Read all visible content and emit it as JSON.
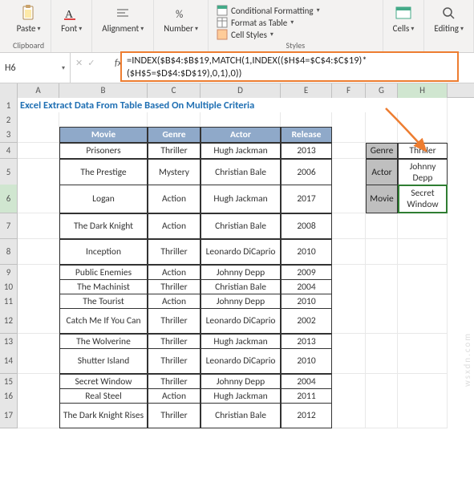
{
  "ribbon": {
    "clipboard": {
      "paste": "Paste",
      "label": "Clipboard"
    },
    "font": {
      "btn": "Font"
    },
    "alignment": {
      "btn": "Alignment"
    },
    "number": {
      "btn": "Number"
    },
    "styles": {
      "conditional": "Conditional Formatting",
      "table": "Format as Table",
      "cell": "Cell Styles",
      "label": "Styles"
    },
    "cells": {
      "btn": "Cells"
    },
    "editing": {
      "btn": "Editing"
    }
  },
  "namebox": "H6",
  "fx_label": "fx",
  "formula": "=INDEX($B$4:$B$19,MATCH(1,INDEX(($H$4=$C$4:$C$19)*($H$5=$D$4:$D$19),0,1),0))",
  "columns": [
    "A",
    "B",
    "C",
    "D",
    "E",
    "F",
    "G",
    "H"
  ],
  "title": "Excel Extract Data From Table Based On Multiple Criteria",
  "headers": {
    "movie": "Movie",
    "genre": "Genre",
    "actor": "Actor",
    "release": "Release"
  },
  "table": [
    {
      "movie": "Prisoners",
      "genre": "Thriller",
      "actor": "Hugh Jackman",
      "release": "2013"
    },
    {
      "movie": "The Prestige",
      "genre": "Mystery",
      "actor": "Christian Bale",
      "release": "2006"
    },
    {
      "movie": "Logan",
      "genre": "Action",
      "actor": "Hugh Jackman",
      "release": "2017"
    },
    {
      "movie": "The Dark Knight",
      "genre": "Action",
      "actor": "Christian Bale",
      "release": "2008"
    },
    {
      "movie": "Inception",
      "genre": "Thriller",
      "actor": "Leonardo DiCaprio",
      "release": "2010"
    },
    {
      "movie": "Public Enemies",
      "genre": "Action",
      "actor": "Johnny Depp",
      "release": "2009"
    },
    {
      "movie": "The Machinist",
      "genre": "Thriller",
      "actor": "Christian Bale",
      "release": "2004"
    },
    {
      "movie": "The Tourist",
      "genre": "Action",
      "actor": "Johnny Depp",
      "release": "2010"
    },
    {
      "movie": "Catch Me If You Can",
      "genre": "Thriller",
      "actor": "Leonardo DiCaprio",
      "release": "2002"
    },
    {
      "movie": "The Wolverine",
      "genre": "Thriller",
      "actor": "Hugh Jackman",
      "release": "2013"
    },
    {
      "movie": "Shutter Island",
      "genre": "Thriller",
      "actor": "Leonardo DiCaprio",
      "release": "2010"
    },
    {
      "movie": "Secret Window",
      "genre": "Thriller",
      "actor": "Johnny Depp",
      "release": "2004"
    },
    {
      "movie": "Real Steel",
      "genre": "Action",
      "actor": "Hugh Jackman",
      "release": "2011"
    },
    {
      "movie": "The Dark Knight Rises",
      "genre": "Thriller",
      "actor": "Christian Bale",
      "release": "2012"
    }
  ],
  "side": {
    "genre_label": "Genre",
    "genre_value": "Thriller",
    "actor_label": "Actor",
    "actor_value": "Johnny Depp",
    "movie_label": "Movie",
    "movie_value": "Secret Window"
  },
  "row_heights": [
    "h18",
    "h18",
    "h20",
    "h20",
    "h32",
    "h36",
    "h32",
    "h32",
    "h18",
    "h18",
    "h18",
    "h32",
    "h18",
    "h32",
    "h18",
    "h18",
    "h32"
  ],
  "watermark": "wsxdn.com"
}
